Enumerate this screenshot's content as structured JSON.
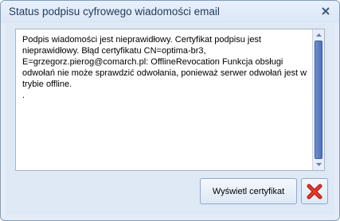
{
  "window": {
    "title": "Status podpisu cyfrowego wiadomości email"
  },
  "message": {
    "text": "Podpis wiadomości jest nieprawidłowy. Certyfikat podpisu jest\nnieprawidłowy. Błąd certyfikatu CN=optima-br3,\nE=grzegorz.pierog@comarch.pl: OfflineRevocation Funkcja obsługi\nodwołań nie może sprawdzić odwołania, ponieważ serwer odwołań jest w\ntrybie offline.\n."
  },
  "buttons": {
    "show_certificate": "Wyświetl certyfikat"
  },
  "icons": {
    "close": "close-icon",
    "cancel": "red-x-icon",
    "scroll_up": "scroll-up-arrow-icon",
    "scroll_down": "scroll-down-arrow-icon"
  },
  "colors": {
    "title_text": "#1e395b",
    "cancel_x": "#d9261c"
  }
}
